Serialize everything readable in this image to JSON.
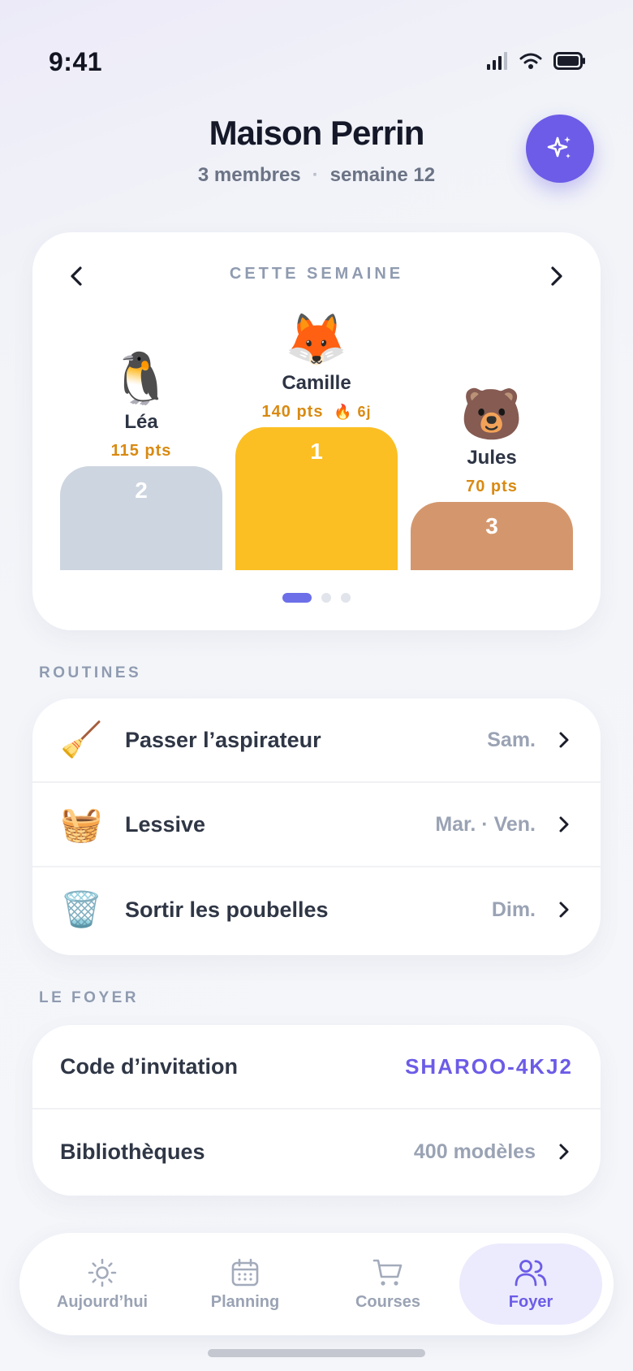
{
  "status_bar": {
    "time": "9:41"
  },
  "header": {
    "title": "Maison Perrin",
    "members": "3 membres",
    "separator": "·",
    "week": "semaine 12"
  },
  "podium": {
    "label": "CETTE SEMAINE",
    "first": {
      "rank": "1",
      "avatar": "🦊",
      "name": "Camille",
      "points": "140 pts",
      "streak": "🔥 6j",
      "color": "#fbbf24"
    },
    "second": {
      "rank": "2",
      "avatar": "🐧",
      "name": "Léa",
      "points": "115 pts",
      "color": "#cdd5e0"
    },
    "third": {
      "rank": "3",
      "avatar": "🐻",
      "name": "Jules",
      "points": "70 pts",
      "color": "#d4976d"
    },
    "pages": 3,
    "active_page": 1
  },
  "routines": {
    "section_label": "ROUTINES",
    "items": [
      {
        "icon": "🧹",
        "label": "Passer l’aspirateur",
        "days": "Sam."
      },
      {
        "icon": "🧺",
        "label": "Lessive",
        "days": "Mar. · Ven."
      },
      {
        "icon": "🗑️",
        "label": "Sortir les poubelles",
        "days": "Dim."
      }
    ]
  },
  "foyer": {
    "section_label": "LE FOYER",
    "invite_label": "Code d’invitation",
    "invite_code": "SHAROO-4KJ2",
    "library_label": "Bibliothèques",
    "library_value": "400 modèles"
  },
  "tabbar": {
    "tabs": [
      {
        "label": "Aujourd’hui",
        "icon": "sun-icon"
      },
      {
        "label": "Planning",
        "icon": "calendar-icon"
      },
      {
        "label": "Courses",
        "icon": "cart-icon"
      },
      {
        "label": "Foyer",
        "icon": "users-icon",
        "active": true
      }
    ]
  },
  "colors": {
    "accent": "#6c5ce7",
    "points": "#d98a12"
  }
}
